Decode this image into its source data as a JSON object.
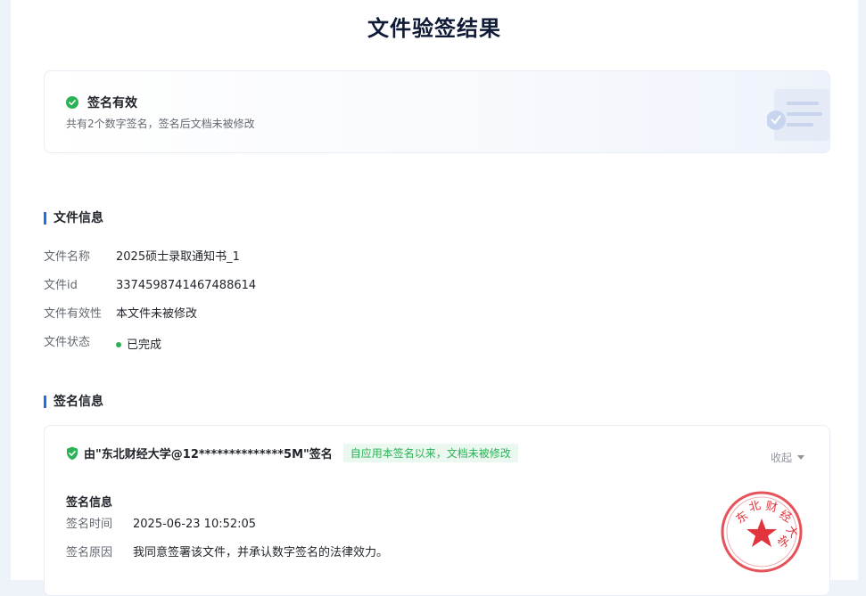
{
  "page_title": "文件验签结果",
  "result": {
    "status": "签名有效",
    "description": "共有2个数字签名，签名后文档未被修改"
  },
  "file_section": {
    "title": "文件信息",
    "rows": [
      {
        "label": "文件名称",
        "value": "2025硕士录取通知书_1"
      },
      {
        "label": "文件id",
        "value": "3374598741467488614"
      },
      {
        "label": "文件有效性",
        "value": "本文件未被修改"
      },
      {
        "label": "文件状态",
        "value": "已完成"
      }
    ]
  },
  "signature_section": {
    "title": "签名信息",
    "card": {
      "signer_title": "由\"东北财经大学@12**************5M\"签名",
      "tag": "自应用本签名以来，文档未被修改",
      "collapse_label": "收起",
      "sub_title": "签名信息",
      "rows": [
        {
          "label": "签名时间",
          "value": "2025-06-23 10:52:05"
        },
        {
          "label": "签名原因",
          "value": "我同意签署该文件，并承认数字签名的法律效力。"
        }
      ],
      "stamp_text": "东北财经大学"
    }
  },
  "colors": {
    "accent": "#1f6fe5",
    "success": "#2bb256",
    "stamp": "#e2343c"
  }
}
